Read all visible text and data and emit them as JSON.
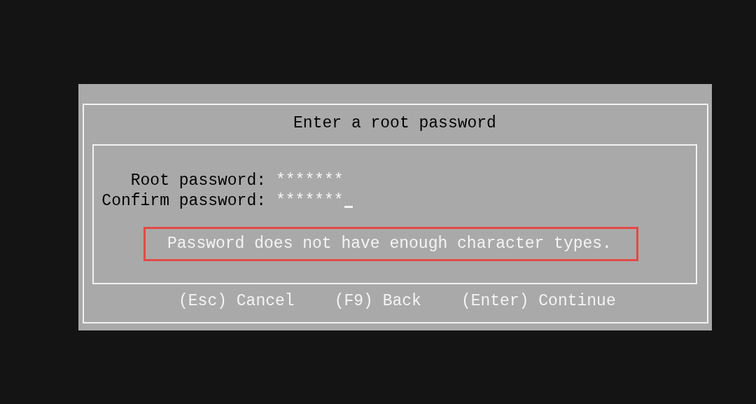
{
  "dialog": {
    "title": "Enter a root password",
    "fields": [
      {
        "label": "Root password:",
        "value": "*******",
        "focused": false
      },
      {
        "label": "Confirm password:",
        "value": "*******",
        "focused": true
      }
    ],
    "error": {
      "text": "Password does not have enough character types.",
      "highlighted": true
    },
    "buttons": [
      {
        "label": "(Esc) Cancel"
      },
      {
        "label": "(F9) Back"
      },
      {
        "label": "(Enter) Continue"
      }
    ]
  }
}
